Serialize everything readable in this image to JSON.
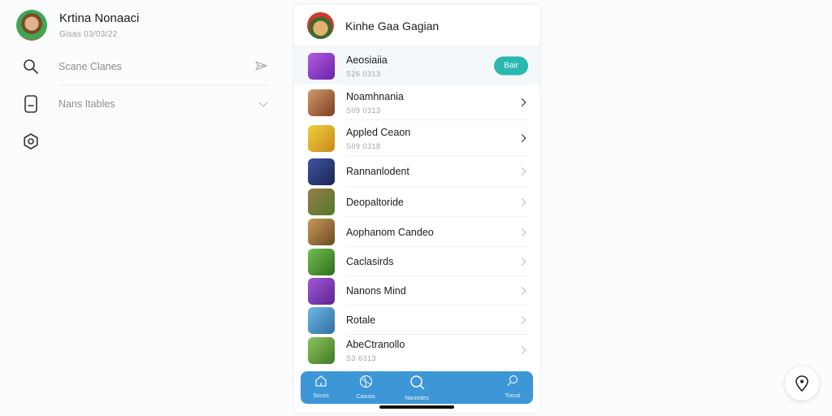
{
  "sidebar": {
    "profile": {
      "name": "Krtina Nonaaci",
      "subtitle": "Gisas 03/03/22"
    },
    "items": [
      {
        "label": "Scane Clanes",
        "icon": "search-icon",
        "trail": "share-icon"
      },
      {
        "label": "Nans Itables",
        "icon": "phone-icon",
        "trail": "chevron-down-icon"
      },
      {
        "label": "",
        "icon": "settings-icon"
      }
    ]
  },
  "panel": {
    "title": "Kinhe Gaa Gagian",
    "items": [
      {
        "title": "Aeosiaiia",
        "subtitle": "S26 0313",
        "action": "Bair",
        "thumb": "#8b3fc7"
      },
      {
        "title": "Noamhnania",
        "subtitle": "S09 0313",
        "thumb": "#a8643a"
      },
      {
        "title": "Appled Ceaon",
        "subtitle": "S09 0318",
        "thumb": "#e1b829"
      },
      {
        "title": "Rannanlodent",
        "subtitle": "",
        "thumb": "#2b3a78"
      },
      {
        "title": "Deopaltoride",
        "subtitle": "",
        "thumb": "#6d8b3a"
      },
      {
        "title": "Aophanom Candeo",
        "subtitle": "",
        "thumb": "#9a6a2b"
      },
      {
        "title": "Caclasirds",
        "subtitle": "",
        "thumb": "#4f9a36"
      },
      {
        "title": "Nanons Mind",
        "subtitle": "",
        "thumb": "#8a3fc0"
      },
      {
        "title": "Rotale",
        "subtitle": "",
        "thumb": "#3c8fcf"
      },
      {
        "title": "AbeCtranollo",
        "subtitle": "S3 6313",
        "thumb": "#6aa03a"
      }
    ]
  },
  "tabs": [
    {
      "label": "Souss",
      "icon": "home-icon"
    },
    {
      "label": "Casuss",
      "icon": "globe-icon"
    },
    {
      "label": "Naniedes",
      "icon": "search-icon"
    },
    {
      "label": "Toouti",
      "icon": "profile-icon"
    }
  ]
}
